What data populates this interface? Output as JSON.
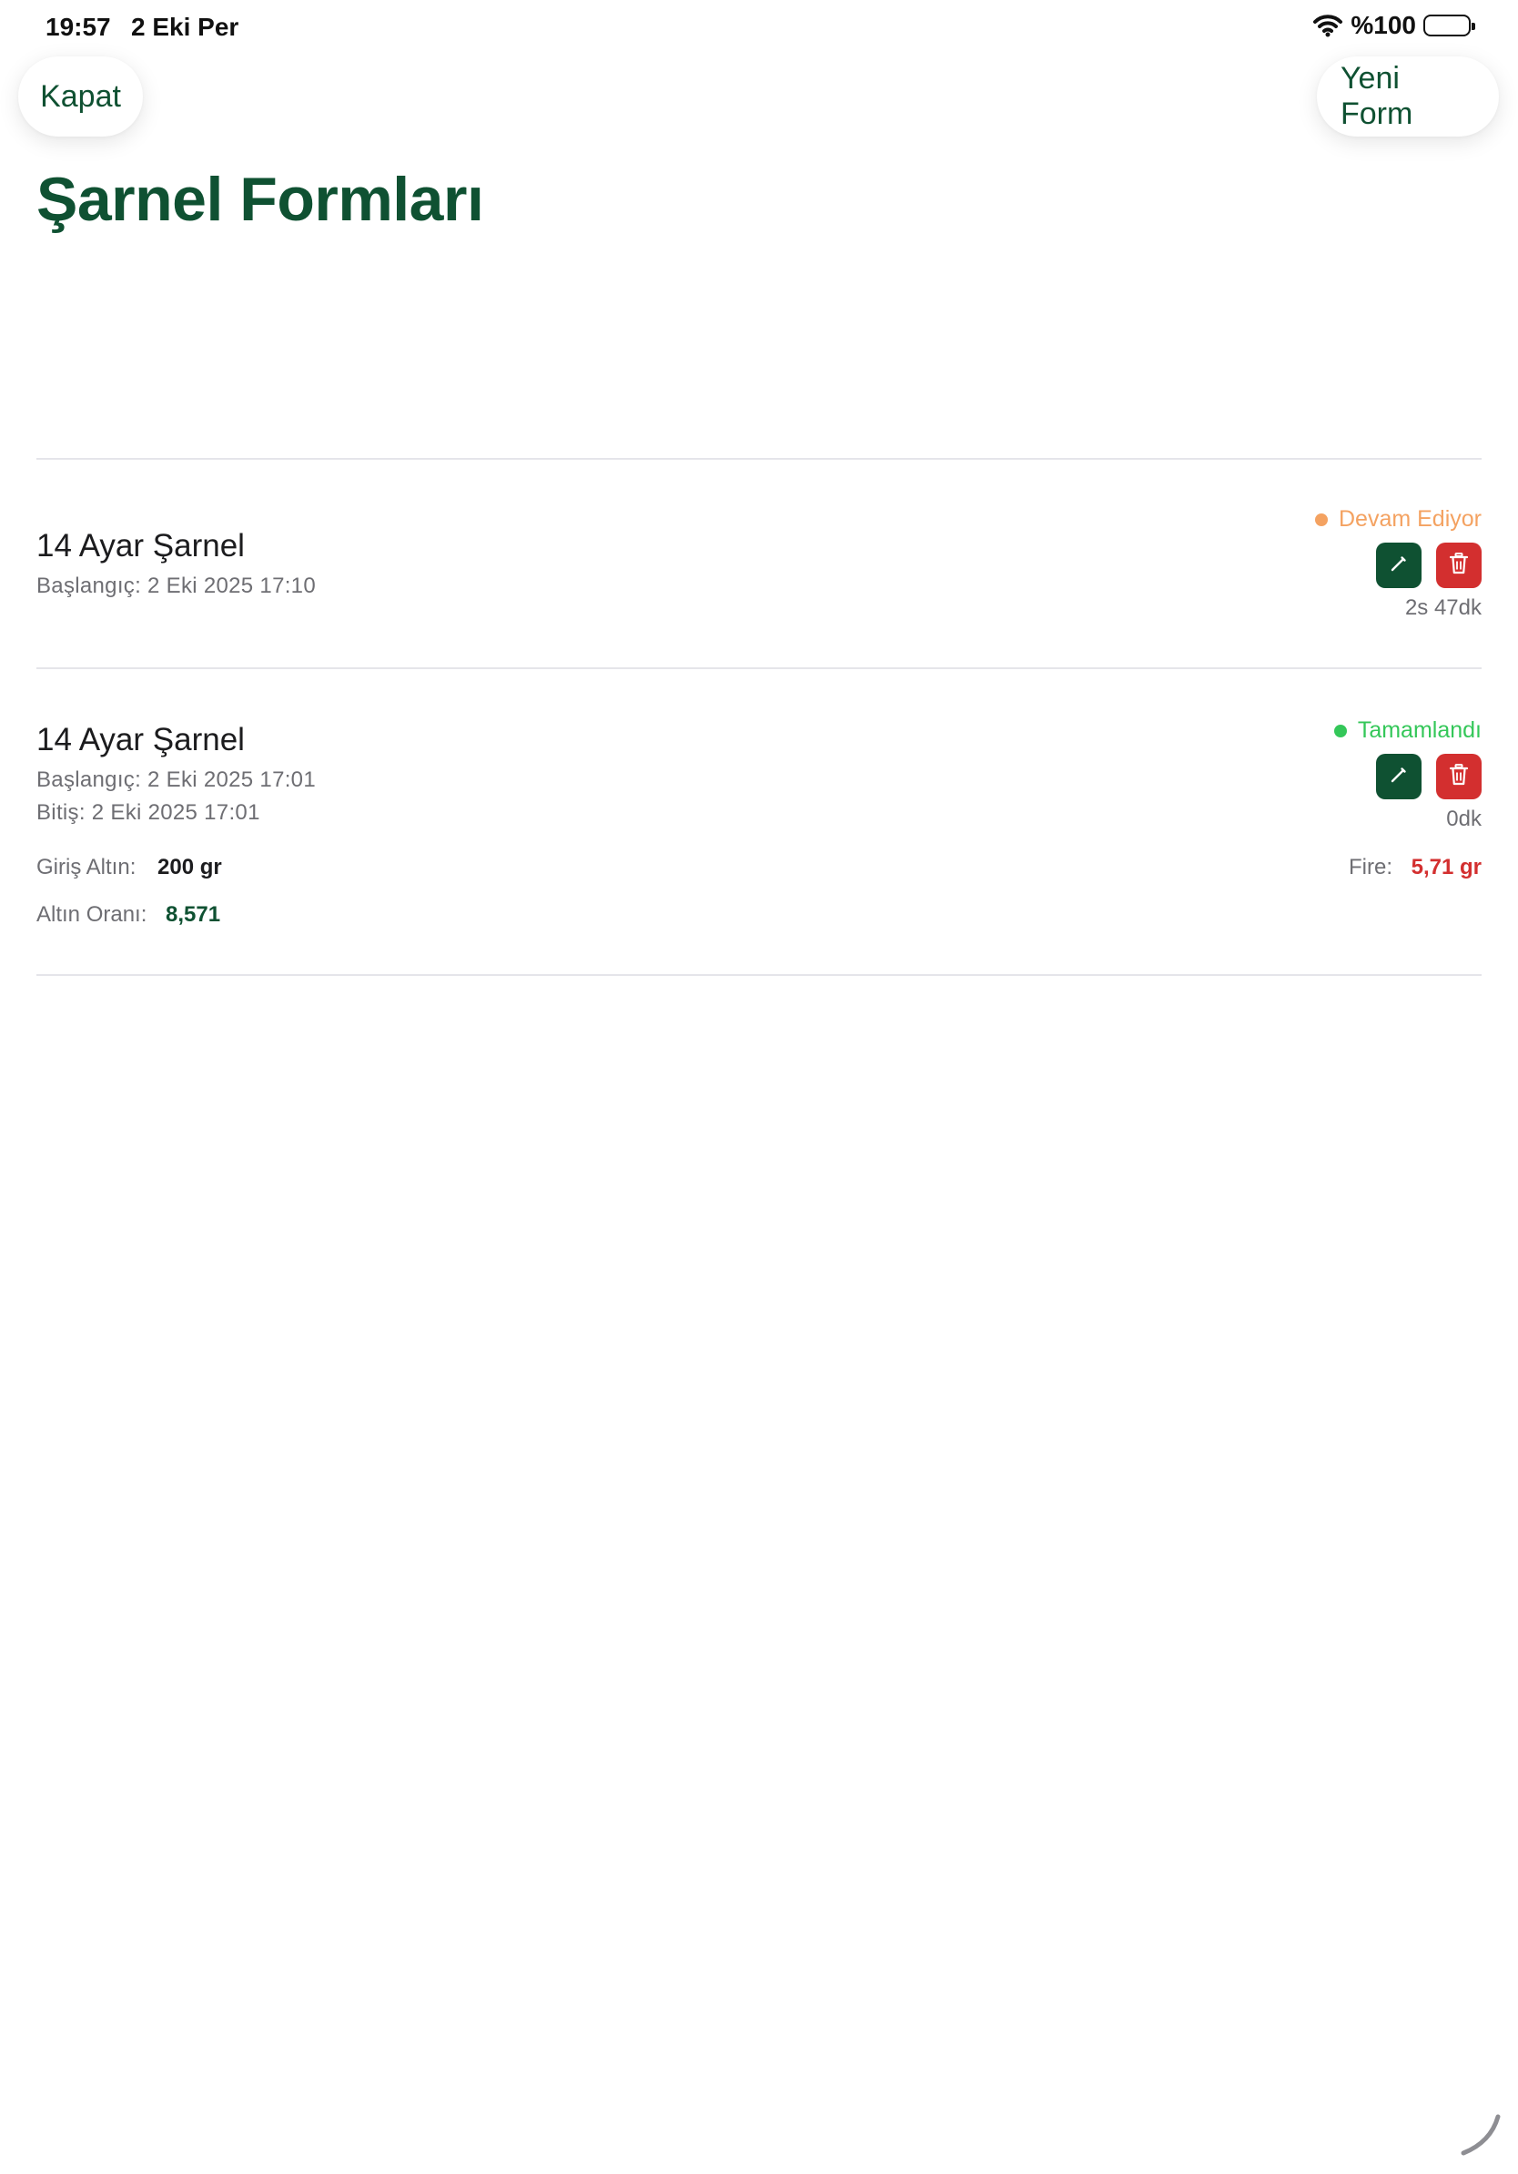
{
  "status_bar": {
    "time": "19:57",
    "date": "2 Eki Per",
    "battery": "%100"
  },
  "toolbar": {
    "close_label": "Kapat",
    "new_form_label": "Yeni Form"
  },
  "page": {
    "title": "Şarnel Formları"
  },
  "forms": [
    {
      "title": "14 Ayar Şarnel",
      "start": "Başlangıç: 2 Eki 2025 17:10",
      "status": "Devam Ediyor",
      "status_color": "#f4a261",
      "duration": "2s 47dk"
    },
    {
      "title": "14 Ayar Şarnel",
      "start": "Başlangıç: 2 Eki 2025 17:01",
      "end": "Bitiş: 2 Eki 2025 17:01",
      "status": "Tamamlandı",
      "status_color": "#34c759",
      "duration": "0dk",
      "input_gold_label": "Giriş Altın:",
      "input_gold_value": "200 gr",
      "fire_label": "Fire:",
      "fire_value": "5,71 gr",
      "gold_ratio_label": "Altın Oranı:",
      "gold_ratio_value": "8,571"
    }
  ],
  "colors": {
    "brand": "#0f5132",
    "danger": "#d32f2f",
    "in_progress": "#f4a261",
    "completed": "#34c759"
  },
  "icons": {
    "edit": "pencil-icon",
    "delete": "trash-icon"
  }
}
